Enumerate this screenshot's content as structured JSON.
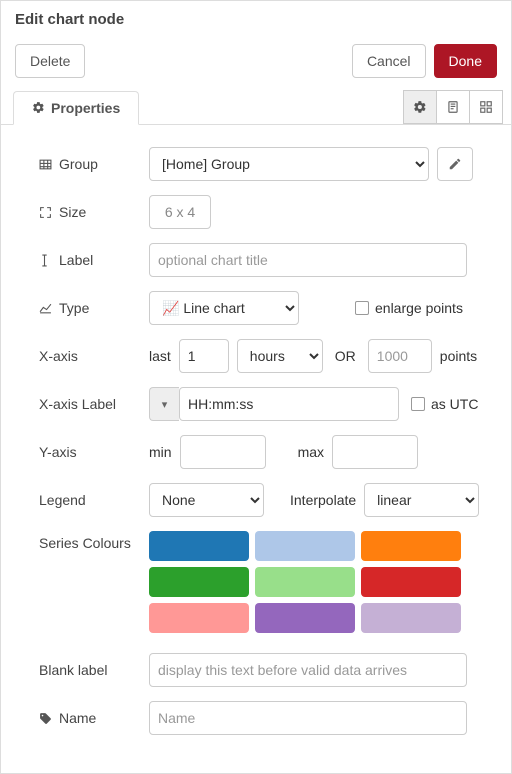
{
  "header": {
    "title": "Edit chart node"
  },
  "buttons": {
    "delete": "Delete",
    "cancel": "Cancel",
    "done": "Done"
  },
  "tabs": {
    "properties_icon": "gear-icon",
    "properties_label": "Properties"
  },
  "form": {
    "group": {
      "label": "Group",
      "value": "[Home] Group"
    },
    "size": {
      "label": "Size",
      "value": "6 x 4"
    },
    "label": {
      "label": "Label",
      "placeholder": "optional chart title",
      "value": ""
    },
    "type": {
      "label": "Type",
      "value": "Line chart",
      "enlarge_label": "enlarge points",
      "enlarge_checked": false
    },
    "xaxis": {
      "label": "X-axis",
      "prefix": "last",
      "number": "1",
      "unit": "hours",
      "or": "OR",
      "points_placeholder": "1000",
      "points_suffix": "points"
    },
    "xaxis_label": {
      "label": "X-axis Label",
      "value": "HH:mm:ss",
      "utc_label": "as UTC",
      "utc_checked": false
    },
    "yaxis": {
      "label": "Y-axis",
      "min_label": "min",
      "min_value": "",
      "max_label": "max",
      "max_value": ""
    },
    "legend": {
      "label": "Legend",
      "value": "None",
      "interpolate_label": "Interpolate",
      "interpolate_value": "linear"
    },
    "series_colours": {
      "label": "Series Colours",
      "colors": [
        "#1f77b4",
        "#aec7e8",
        "#ff7f0e",
        "#2ca02c",
        "#98df8a",
        "#d62728",
        "#ff9896",
        "#9467bd",
        "#c5b0d5"
      ]
    },
    "blank_label": {
      "label": "Blank label",
      "placeholder": "display this text before valid data arrives",
      "value": ""
    },
    "name": {
      "label": "Name",
      "placeholder": "Name",
      "value": ""
    }
  }
}
